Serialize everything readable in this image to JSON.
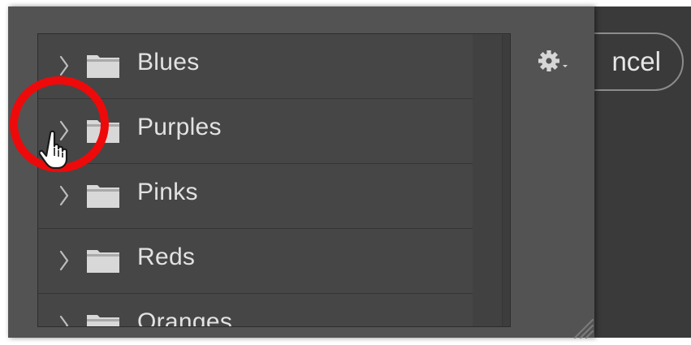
{
  "folder_list": {
    "items": [
      {
        "label": "Blues",
        "icon": "folder-icon",
        "expand_icon": "chevron-right-icon"
      },
      {
        "label": "Purples",
        "icon": "folder-icon",
        "expand_icon": "chevron-right-icon"
      },
      {
        "label": "Pinks",
        "icon": "folder-icon",
        "expand_icon": "chevron-right-icon"
      },
      {
        "label": "Reds",
        "icon": "folder-icon",
        "expand_icon": "chevron-right-icon"
      },
      {
        "label": "Oranges",
        "icon": "folder-icon",
        "expand_icon": "chevron-right-icon"
      }
    ]
  },
  "toolbar": {
    "gear_icon": "gear-icon",
    "gear_menu_indicator": "dropdown-arrow-icon"
  },
  "dialog": {
    "cancel_label": "ncel"
  },
  "annotation": {
    "shape": "circle",
    "color": "#ee0a0a",
    "cursor_icon": "hand-pointer-icon"
  },
  "colors": {
    "panel": "#535353",
    "list_background": "#464646",
    "text": "#e2e2e2",
    "highlight_circle": "#ee0a0a"
  }
}
